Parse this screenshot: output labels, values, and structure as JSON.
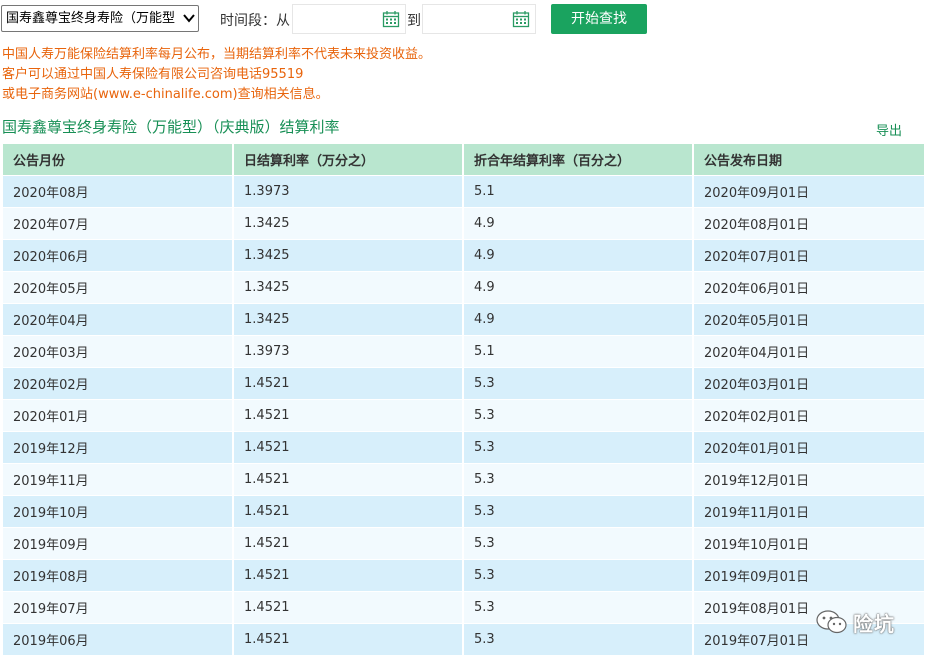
{
  "filter": {
    "product_selected": "国寿鑫尊宝终身寿险（万能型",
    "time_label": "时间段：从",
    "from_value": "",
    "to_label": "到",
    "to_value": "",
    "search_button": "开始查找"
  },
  "notice": {
    "line1": "中国人寿万能保险结算利率每月公布，当期结算利率不代表未来投资收益。",
    "line2": "客户可以通过中国人寿保险有限公司咨询电话95519",
    "line3": "或电子商务网站(www.e-chinalife.com)查询相关信息。"
  },
  "table_title": "国寿鑫尊宝终身寿险（万能型）（庆典版）结算利率",
  "export_label": "导出",
  "table": {
    "headers": [
      "公告月份",
      "日结算利率（万分之）",
      "折合年结算利率（百分之）",
      "公告发布日期"
    ],
    "rows": [
      [
        "2020年08月",
        "1.3973",
        "5.1",
        "2020年09月01日"
      ],
      [
        "2020年07月",
        "1.3425",
        "4.9",
        "2020年08月01日"
      ],
      [
        "2020年06月",
        "1.3425",
        "4.9",
        "2020年07月01日"
      ],
      [
        "2020年05月",
        "1.3425",
        "4.9",
        "2020年06月01日"
      ],
      [
        "2020年04月",
        "1.3425",
        "4.9",
        "2020年05月01日"
      ],
      [
        "2020年03月",
        "1.3973",
        "5.1",
        "2020年04月01日"
      ],
      [
        "2020年02月",
        "1.4521",
        "5.3",
        "2020年03月01日"
      ],
      [
        "2020年01月",
        "1.4521",
        "5.3",
        "2020年02月01日"
      ],
      [
        "2019年12月",
        "1.4521",
        "5.3",
        "2020年01月01日"
      ],
      [
        "2019年11月",
        "1.4521",
        "5.3",
        "2019年12月01日"
      ],
      [
        "2019年10月",
        "1.4521",
        "5.3",
        "2019年11月01日"
      ],
      [
        "2019年09月",
        "1.4521",
        "5.3",
        "2019年10月01日"
      ],
      [
        "2019年08月",
        "1.4521",
        "5.3",
        "2019年09月01日"
      ],
      [
        "2019年07月",
        "1.4521",
        "5.3",
        "2019年08月01日"
      ],
      [
        "2019年06月",
        "1.4521",
        "5.3",
        "2019年07月01日"
      ]
    ]
  },
  "watermark": {
    "text": "险坑",
    "icon": "wechat-icon"
  },
  "colors": {
    "accent_green": "#1aa35f",
    "title_green": "#178f55",
    "notice_orange": "#e8640c",
    "header_bg": "#b9e6cf",
    "row_odd": "#d7effb",
    "row_even": "#f2fafe"
  }
}
